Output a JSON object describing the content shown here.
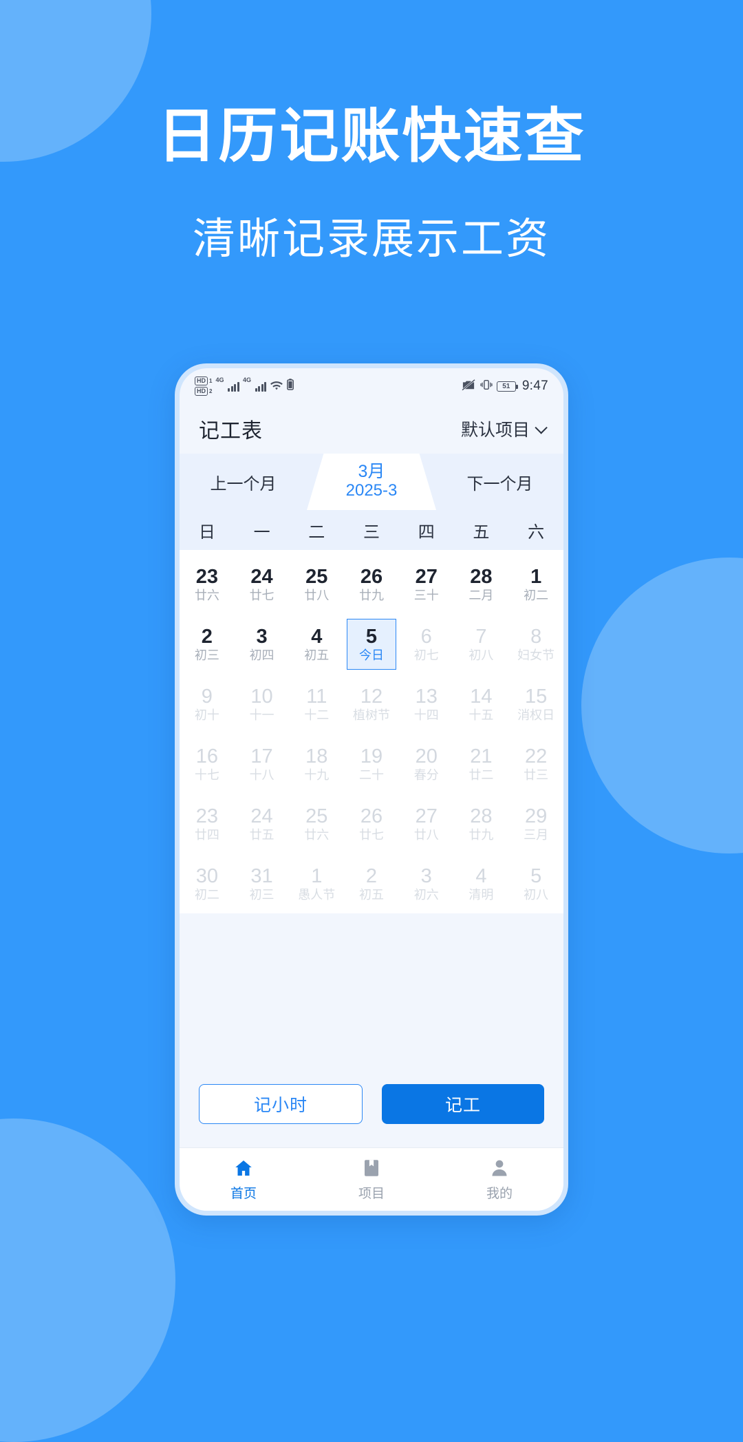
{
  "promo": {
    "title": "日历记账快速查",
    "subtitle": "清晰记录展示工资"
  },
  "colors": {
    "bg": "#3399FB",
    "blob": "#8CC6FC",
    "accent": "#2A87F5",
    "primary_button": "#0A76E4"
  },
  "status_bar": {
    "hd_label_1": "HD",
    "hd_sub_1": "1",
    "hd_label_2": "HD",
    "hd_sub_2": "2",
    "net_1": "4G",
    "net_2": "4G",
    "wifi": "wifi-icon",
    "battery_small": "battery-icon",
    "mute_icon": "mute-camera-icon",
    "vibrate_icon": "vibrate-icon",
    "battery_level": "51",
    "time": "9:47"
  },
  "app_header": {
    "title": "记工表",
    "project": "默认项目",
    "chevron": "chevron-down-icon"
  },
  "month_switcher": {
    "prev": "上一个月",
    "current_month": "3月",
    "current_ym": "2025-3",
    "next": "下一个月"
  },
  "weekdays": [
    "日",
    "一",
    "二",
    "三",
    "四",
    "五",
    "六"
  ],
  "calendar": {
    "weeks": [
      [
        {
          "num": "23",
          "sub": "廿六",
          "state": "muted"
        },
        {
          "num": "24",
          "sub": "廿七",
          "state": "muted"
        },
        {
          "num": "25",
          "sub": "廿八",
          "state": "muted"
        },
        {
          "num": "26",
          "sub": "廿九",
          "state": "muted"
        },
        {
          "num": "27",
          "sub": "三十",
          "state": "muted"
        },
        {
          "num": "28",
          "sub": "二月",
          "state": "muted"
        },
        {
          "num": "1",
          "sub": "初二",
          "state": "muted"
        }
      ],
      [
        {
          "num": "2",
          "sub": "初三",
          "state": "muted"
        },
        {
          "num": "3",
          "sub": "初四",
          "state": "muted"
        },
        {
          "num": "4",
          "sub": "初五",
          "state": "muted"
        },
        {
          "num": "5",
          "sub": "今日",
          "state": "today"
        },
        {
          "num": "6",
          "sub": "初七",
          "state": "dim"
        },
        {
          "num": "7",
          "sub": "初八",
          "state": "dim"
        },
        {
          "num": "8",
          "sub": "妇女节",
          "state": "dim"
        }
      ],
      [
        {
          "num": "9",
          "sub": "初十",
          "state": "dim"
        },
        {
          "num": "10",
          "sub": "十一",
          "state": "dim"
        },
        {
          "num": "11",
          "sub": "十二",
          "state": "dim"
        },
        {
          "num": "12",
          "sub": "植树节",
          "state": "dim"
        },
        {
          "num": "13",
          "sub": "十四",
          "state": "dim"
        },
        {
          "num": "14",
          "sub": "十五",
          "state": "dim"
        },
        {
          "num": "15",
          "sub": "消权日",
          "state": "dim"
        }
      ],
      [
        {
          "num": "16",
          "sub": "十七",
          "state": "dim"
        },
        {
          "num": "17",
          "sub": "十八",
          "state": "dim"
        },
        {
          "num": "18",
          "sub": "十九",
          "state": "dim"
        },
        {
          "num": "19",
          "sub": "二十",
          "state": "dim"
        },
        {
          "num": "20",
          "sub": "春分",
          "state": "dim"
        },
        {
          "num": "21",
          "sub": "廿二",
          "state": "dim"
        },
        {
          "num": "22",
          "sub": "廿三",
          "state": "dim"
        }
      ],
      [
        {
          "num": "23",
          "sub": "廿四",
          "state": "dim"
        },
        {
          "num": "24",
          "sub": "廿五",
          "state": "dim"
        },
        {
          "num": "25",
          "sub": "廿六",
          "state": "dim"
        },
        {
          "num": "26",
          "sub": "廿七",
          "state": "dim"
        },
        {
          "num": "27",
          "sub": "廿八",
          "state": "dim"
        },
        {
          "num": "28",
          "sub": "廿九",
          "state": "dim"
        },
        {
          "num": "29",
          "sub": "三月",
          "state": "dim"
        }
      ],
      [
        {
          "num": "30",
          "sub": "初二",
          "state": "dim"
        },
        {
          "num": "31",
          "sub": "初三",
          "state": "dim"
        },
        {
          "num": "1",
          "sub": "愚人节",
          "state": "dim"
        },
        {
          "num": "2",
          "sub": "初五",
          "state": "dim"
        },
        {
          "num": "3",
          "sub": "初六",
          "state": "dim"
        },
        {
          "num": "4",
          "sub": "清明",
          "state": "dim"
        },
        {
          "num": "5",
          "sub": "初八",
          "state": "dim"
        }
      ]
    ]
  },
  "actions": {
    "hours_label": "记小时",
    "work_label": "记工"
  },
  "tab_bar": {
    "items": [
      {
        "label": "首页",
        "icon": "home-icon",
        "active": true
      },
      {
        "label": "项目",
        "icon": "bookmark-icon",
        "active": false
      },
      {
        "label": "我的",
        "icon": "person-icon",
        "active": false
      }
    ]
  }
}
